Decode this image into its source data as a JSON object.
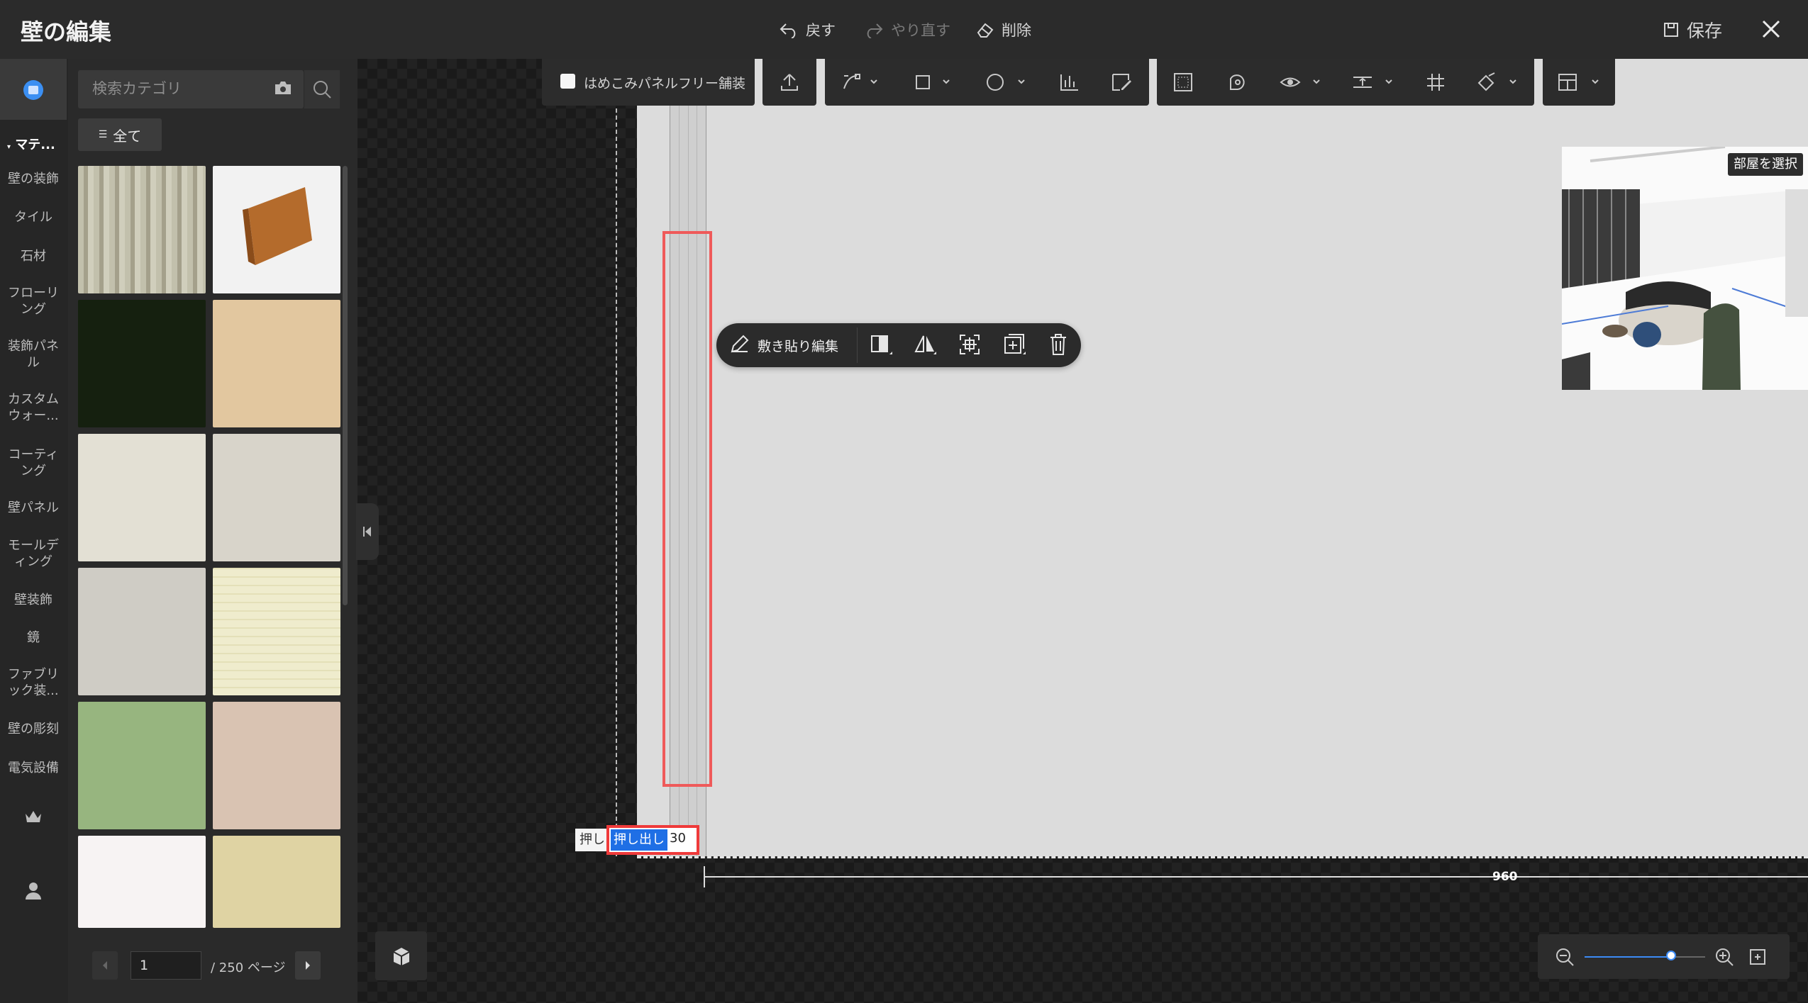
{
  "window": {
    "title": "壁の編集",
    "undo_label": "戻す",
    "redo_label": "やり直す",
    "delete_label": "削除",
    "save_label": "保存"
  },
  "sidebar": {
    "section_label": "マテ...",
    "categories": [
      {
        "label": "壁の装飾"
      },
      {
        "label": "タイル"
      },
      {
        "label": "石材"
      },
      {
        "label": "フローリ\nング"
      },
      {
        "label": "装飾パネ\nル"
      },
      {
        "label": "カスタム\nウォー..."
      },
      {
        "label": "コーティ\nング"
      },
      {
        "label": "壁パネル"
      },
      {
        "label": "モールデ\nィング"
      },
      {
        "label": "壁装飾"
      },
      {
        "label": "鏡"
      },
      {
        "label": "ファブリ\nック装..."
      },
      {
        "label": "壁の彫刻"
      },
      {
        "label": "電気設備"
      }
    ]
  },
  "library": {
    "search_placeholder": "検索カテゴリ",
    "filter_label": "全て",
    "materials": [
      {
        "name": "weathered-wood-planks",
        "color": "#b3b09b"
      },
      {
        "name": "wood-baseboard-molding",
        "color": "#f2f2f2"
      },
      {
        "name": "dark-green-plain",
        "color": "#15200f"
      },
      {
        "name": "light-oak-wood",
        "color": "#e2c79f"
      },
      {
        "name": "cream-marble-tile",
        "color": "#e3e0d4"
      },
      {
        "name": "light-grey-wood",
        "color": "#d8d4ca"
      },
      {
        "name": "grey-plaster",
        "color": "#cfccc5"
      },
      {
        "name": "cream-check-fabric",
        "color": "#efeccd"
      },
      {
        "name": "green-plaster",
        "color": "#97b57f"
      },
      {
        "name": "beige-marble",
        "color": "#d9c3b2"
      },
      {
        "name": "white-leaf-pattern",
        "color": "#f7f3f3"
      },
      {
        "name": "gold-damask",
        "color": "#dfd3a3"
      }
    ],
    "pagination": {
      "current": "1",
      "total_label": "/ 250 ページ"
    }
  },
  "toolbar": {
    "panel_free_label": "はめこみパネルフリー舗装"
  },
  "context_toolbar": {
    "tile_edit_label": "敷き貼り編集"
  },
  "extrude": {
    "prefix": "押し",
    "label": "押し出し",
    "value": "30"
  },
  "dimension": {
    "value": "960"
  },
  "preview": {
    "room_select_label": "部屋を選択"
  },
  "zoom": {
    "level": 0.72
  },
  "colors": {
    "accent_blue": "#1f6fe5",
    "highlight_red": "#ef5a5a"
  }
}
